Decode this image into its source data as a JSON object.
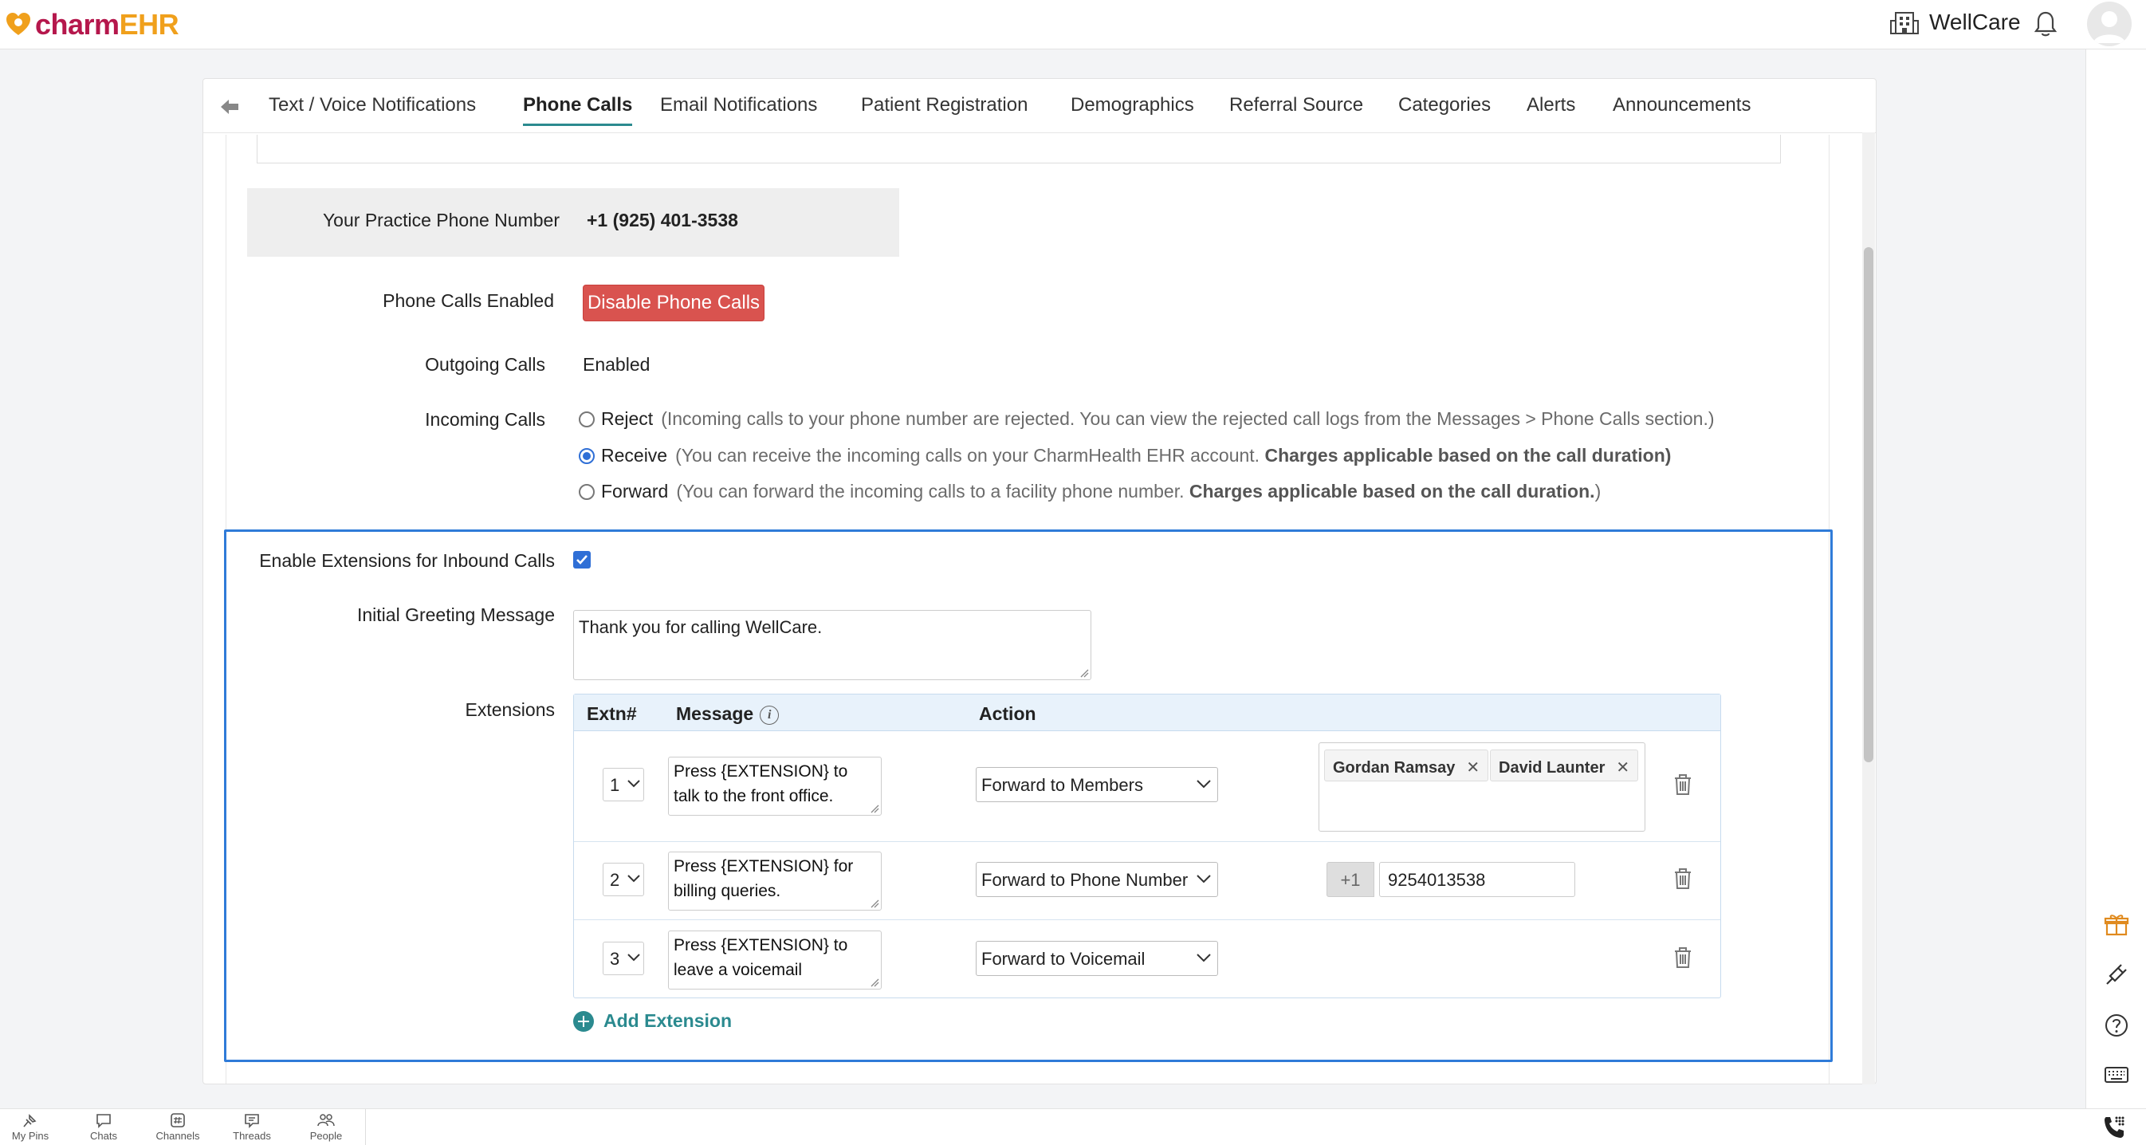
{
  "app": {
    "logo_charm": "charm",
    "logo_ehr": "EHR",
    "org_name": "WellCare"
  },
  "tabs": [
    {
      "label": "Text / Voice Notifications"
    },
    {
      "label": "Phone Calls"
    },
    {
      "label": "Email Notifications"
    },
    {
      "label": "Patient Registration"
    },
    {
      "label": "Demographics"
    },
    {
      "label": "Referral Source"
    },
    {
      "label": "Categories"
    },
    {
      "label": "Alerts"
    },
    {
      "label": "Announcements"
    }
  ],
  "active_tab": "Phone Calls",
  "practice": {
    "label": "Your Practice Phone Number",
    "number": "+1 (925) 401-3538"
  },
  "phone_calls_enabled": {
    "label": "Phone Calls Enabled",
    "button": "Disable Phone Calls"
  },
  "outgoing_calls": {
    "label": "Outgoing Calls",
    "value": "Enabled"
  },
  "incoming_calls": {
    "label": "Incoming Calls",
    "selected": "Receive",
    "options": [
      {
        "label": "Reject",
        "desc": "(Incoming calls to your phone number are rejected. You can view the rejected call logs from the Messages > Phone Calls section.)",
        "bold": ""
      },
      {
        "label": "Receive",
        "desc": "(You can receive the incoming calls on your CharmHealth EHR account. ",
        "bold": "Charges applicable based on the call duration)"
      },
      {
        "label": "Forward",
        "desc": "(You can forward the incoming calls to a facility phone number. ",
        "bold": "Charges applicable based on the call duration.",
        "tail": ")"
      }
    ]
  },
  "extensions_section": {
    "enable_label": "Enable Extensions for Inbound Calls",
    "enabled": true,
    "greeting_label": "Initial Greeting Message",
    "greeting_value": "Thank you for calling WellCare.",
    "extensions_label": "Extensions",
    "headers": {
      "extn": "Extn#",
      "message": "Message",
      "action": "Action"
    },
    "rows": [
      {
        "extn": "1",
        "message_line1": "Press {EXTENSION} to",
        "message_line2": "talk to the front office.",
        "action": "Forward to Members",
        "members": [
          "Gordan Ramsay",
          "David Launter"
        ]
      },
      {
        "extn": "2",
        "message_line1": "Press {EXTENSION} for",
        "message_line2": "billing queries.",
        "action": "Forward to Phone Number",
        "country_code": "+1",
        "phone": "9254013538"
      },
      {
        "extn": "3",
        "message_line1": "Press {EXTENSION} to",
        "message_line2": "leave a voicemail",
        "action": "Forward to Voicemail"
      }
    ],
    "add_label": "Add Extension"
  },
  "bottom_bar": [
    "My Pins",
    "Chats",
    "Channels",
    "Threads",
    "People"
  ],
  "colors": {
    "accent": "#2b8a8f",
    "danger": "#d9534f",
    "focus": "#2f7bd8",
    "brand": "#b5174c",
    "brand2": "#f0a01c"
  }
}
